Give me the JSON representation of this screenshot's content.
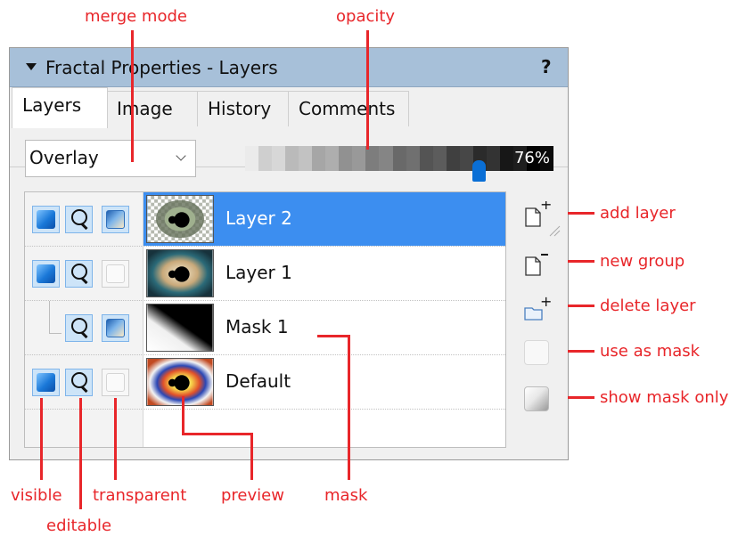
{
  "panel": {
    "title": "Fractal Properties - Layers",
    "help": "?",
    "tabs": [
      {
        "label": "Layers",
        "active": true
      },
      {
        "label": "Image",
        "active": false
      },
      {
        "label": "History",
        "active": false
      },
      {
        "label": "Comments",
        "active": false
      }
    ],
    "merge_mode": {
      "value": "Overlay"
    },
    "opacity": {
      "value_label": "76%",
      "value": 0.76
    },
    "layers": [
      {
        "name": "Layer 2",
        "selected": true,
        "visible": true,
        "editable": true,
        "transparent": true
      },
      {
        "name": "Layer 1",
        "selected": false,
        "visible": true,
        "editable": true,
        "transparent": false
      },
      {
        "name": "Mask 1",
        "selected": false,
        "is_mask": true,
        "editable": true,
        "transparent": true
      },
      {
        "name": "Default",
        "selected": false,
        "visible": true,
        "editable": true,
        "transparent": false
      }
    ]
  },
  "annotations": {
    "merge_mode": "merge mode",
    "opacity": "opacity",
    "add_layer": "add layer",
    "new_group": "new group",
    "delete_layer": "delete layer",
    "use_as_mask": "use as mask",
    "show_mask_only": "show mask only",
    "visible": "visible",
    "editable": "editable",
    "transparent": "transparent",
    "preview": "preview",
    "mask": "mask"
  },
  "colors": {
    "annotation": "#e8262a",
    "title_bar": "#a7c0d9",
    "selection": "#3c8ef0",
    "slider_handle": "#0a6fd6"
  }
}
